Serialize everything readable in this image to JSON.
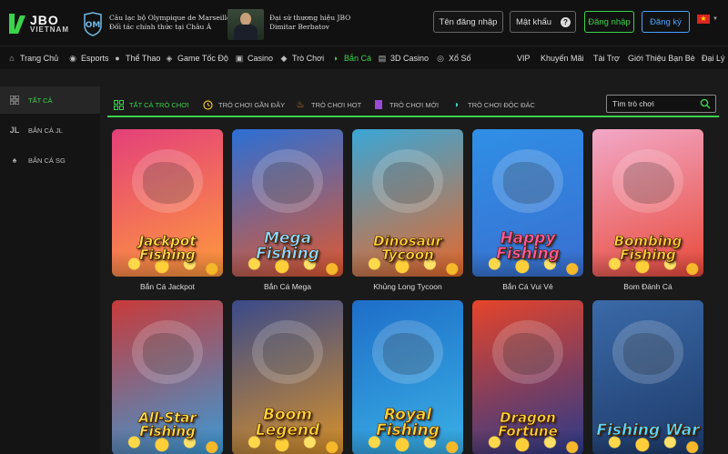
{
  "header": {
    "logo": {
      "line1": "JBO",
      "line2": "VIETNAM"
    },
    "partner1": {
      "line1": "Câu lạc bộ Olympique de Marseille",
      "line2": "Đối tác chính thức tại Châu Á"
    },
    "partner2": {
      "line1": "Đại sứ thương hiệu JBO",
      "line2": "Dimitar Berbatov"
    },
    "username_button": "Tên đăng nhập",
    "password_field": "Mật khẩu",
    "password_help": "?",
    "login_button": "Đăng nhập",
    "register_button": "Đăng ký",
    "language_flag": "★"
  },
  "nav": {
    "items": [
      {
        "label": "Trang Chủ",
        "icon": "home-icon",
        "active": false
      },
      {
        "label": "Esports",
        "icon": "gamepad-icon",
        "active": false
      },
      {
        "label": "Thể Thao",
        "icon": "ball-icon",
        "active": false
      },
      {
        "label": "Game Tốc Độ",
        "icon": "controller-icon",
        "active": false
      },
      {
        "label": "Casino",
        "icon": "cards-icon",
        "active": false
      },
      {
        "label": "Trò Chơi",
        "icon": "dice-icon",
        "active": false
      },
      {
        "label": "Bắn Cá",
        "icon": "fish-icon",
        "active": true
      },
      {
        "label": "3D Casino",
        "icon": "cube-icon",
        "active": false
      },
      {
        "label": "Xổ Số",
        "icon": "lottery-icon",
        "active": false
      },
      {
        "label": "VIP",
        "active": false
      },
      {
        "label": "Khuyến Mãi",
        "active": false
      },
      {
        "label": "Tài Trợ",
        "active": false
      },
      {
        "label": "Giới Thiệu Bạn Bè",
        "active": false
      },
      {
        "label": "Đại Lý",
        "active": false
      }
    ]
  },
  "sidebar": {
    "items": [
      {
        "label": "TẤT CẢ",
        "icon": "grid-icon",
        "active": true
      },
      {
        "label": "BẮN CÁ JL",
        "icon": "jl-icon",
        "active": false
      },
      {
        "label": "BẮN CÁ SG",
        "icon": "spade-icon",
        "active": false
      }
    ],
    "jl_glyph": "JL"
  },
  "tabs": {
    "items": [
      {
        "label": "TẤT CẢ TRÒ CHƠI",
        "icon": "grid-icon",
        "active": true
      },
      {
        "label": "TRÒ CHƠI GẦN ĐÂY",
        "icon": "clock-icon",
        "active": false
      },
      {
        "label": "TRÒ CHƠI HOT",
        "icon": "flame-icon",
        "active": false
      },
      {
        "label": "TRÒ CHƠI MỚI",
        "icon": "new-icon",
        "active": false
      },
      {
        "label": "TRÒ CHƠI ĐỘC ĐÁC",
        "icon": "fish-icon",
        "active": false
      }
    ],
    "search_placeholder": "Tìm trò chơi"
  },
  "games": [
    {
      "name": "Bắn Cá Jackpot",
      "title": "Jackpot Fishing",
      "colors": [
        "#e4407a",
        "#ff9a3c"
      ],
      "title_color": "#ffe14a"
    },
    {
      "name": "Bắn Cá Mega",
      "title": "Mega Fishing",
      "colors": [
        "#2b6fd6",
        "#e0582f"
      ],
      "title_color": "#8fd6ff"
    },
    {
      "name": "Khủng Long Tycoon",
      "title": "Dinosaur Tycoon",
      "colors": [
        "#3aa6d6",
        "#e6682a"
      ],
      "title_color": "#ffd23a"
    },
    {
      "name": "Bắn Cá Vui Vẻ",
      "title": "Happy Fishing",
      "colors": [
        "#2f8fe6",
        "#3a6fd0"
      ],
      "title_color": "#ff5aa0"
    },
    {
      "name": "Bom Đánh Cá",
      "title": "Bombing Fishing",
      "colors": [
        "#f2a8c8",
        "#e84a3a"
      ],
      "title_color": "#ffd23a"
    },
    {
      "name": "",
      "title": "All-Star Fishing",
      "colors": [
        "#c83a3a",
        "#3a9ad6"
      ],
      "title_color": "#ffe14a"
    },
    {
      "name": "",
      "title": "Boom Legend",
      "colors": [
        "#3a4a8a",
        "#d6902a"
      ],
      "title_color": "#ffd23a"
    },
    {
      "name": "",
      "title": "Royal Fishing",
      "colors": [
        "#1e6ec8",
        "#3ab0e6"
      ],
      "title_color": "#ffd23a"
    },
    {
      "name": "",
      "title": "Dragon Fortune",
      "colors": [
        "#e6442a",
        "#2a3a8a"
      ],
      "title_color": "#ffd23a"
    },
    {
      "name": "",
      "title": "Fishing War",
      "colors": [
        "#3a6aa8",
        "#1e3a6a"
      ],
      "title_color": "#5ad6ff"
    }
  ],
  "colors": {
    "accent": "#3ad34a",
    "register": "#4aa3ff",
    "background": "#1a1a1a"
  }
}
